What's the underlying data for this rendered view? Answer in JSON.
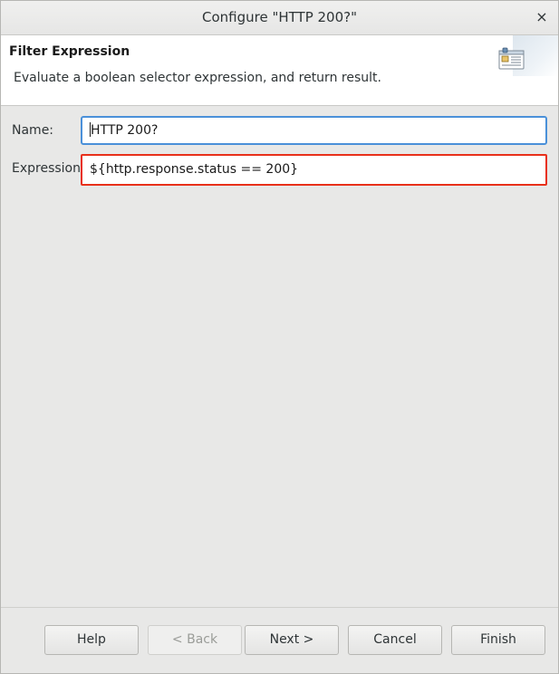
{
  "window": {
    "title": "Configure \"HTTP 200?\"",
    "close_glyph": "×"
  },
  "header": {
    "title": "Filter Expression",
    "description": "Evaluate a boolean selector expression, and return result.",
    "icon": "wizard-banner-icon"
  },
  "form": {
    "name_label": "Name:",
    "name_value": "HTTP 200?",
    "expression_label": "Expression",
    "expression_value": "${http.response.status == 200}"
  },
  "buttons": {
    "help": "Help",
    "back": "< Back",
    "next": "Next >",
    "cancel": "Cancel",
    "finish": "Finish"
  },
  "colors": {
    "focus_border": "#4a90d9",
    "highlight_border": "#e8301a"
  }
}
